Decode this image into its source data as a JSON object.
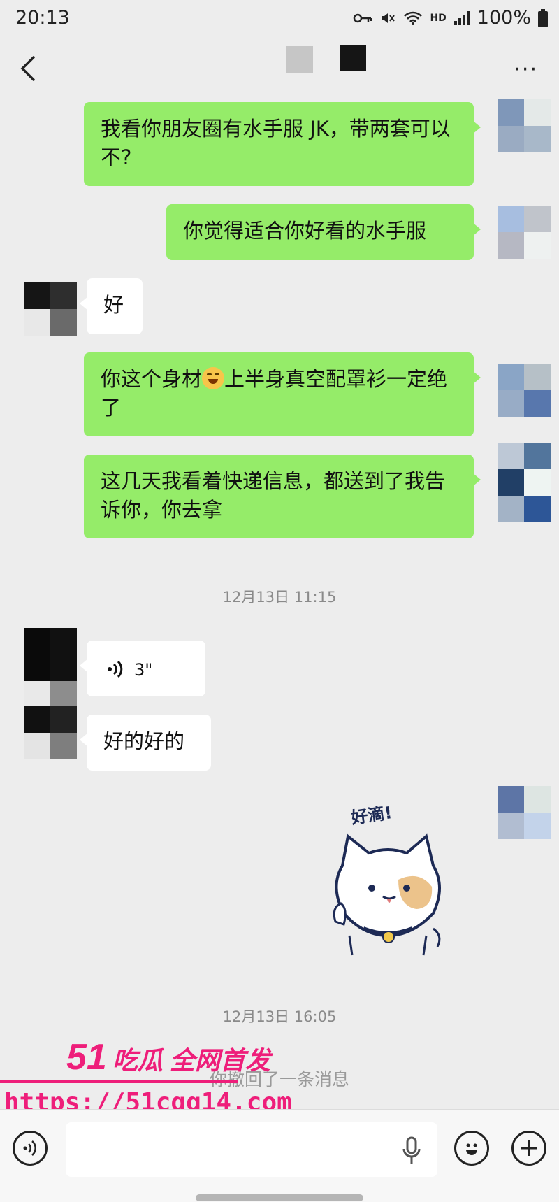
{
  "status_bar": {
    "time": "20:13",
    "hd": "HD",
    "battery": "100%"
  },
  "nav": {
    "more": "···"
  },
  "messages": [
    {
      "id": "m1",
      "text": "我看你朋友圈有水手服 JK，带两套可以不?"
    },
    {
      "id": "m2",
      "text": "你觉得适合你好看的水手服"
    },
    {
      "id": "m3",
      "text": "好"
    },
    {
      "id": "m4",
      "text_a": "你这个身材",
      "text_b": "上半身真空配罩衫一定绝了"
    },
    {
      "id": "m5",
      "text": "这几天我看着快递信息，都送到了我告诉你，你去拿"
    },
    {
      "id": "m6",
      "duration": "3\""
    },
    {
      "id": "m7",
      "text": "好的好的"
    }
  ],
  "timestamps": {
    "first": "12月13日 11:15",
    "second": "12月13日 16:05"
  },
  "sticker": {
    "caption": "好滴!"
  },
  "system_message": "你撤回了一条消息",
  "watermark": {
    "brand_num": "51",
    "brand_text": "吃瓜 全网首发",
    "url": "https://51cgg14.com"
  },
  "input": {
    "placeholder": ""
  }
}
